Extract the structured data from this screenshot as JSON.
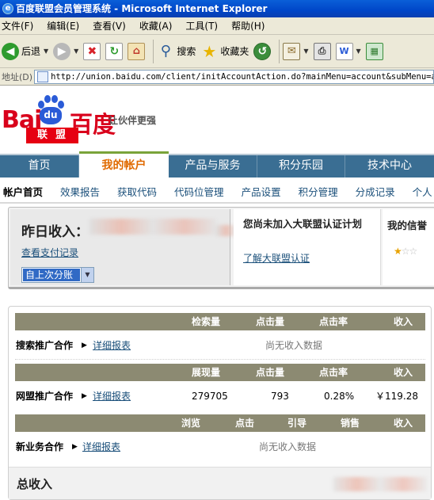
{
  "window": {
    "title": "百度联盟会员管理系统 - Microsoft Internet Explorer"
  },
  "menu": [
    "文件(F)",
    "编辑(E)",
    "查看(V)",
    "收藏(A)",
    "工具(T)",
    "帮助(H)"
  ],
  "toolbar": {
    "back": "后退",
    "search": "搜索",
    "favorites": "收藏夹"
  },
  "address": {
    "label": "地址(D)",
    "url": "http://union.baidu.com/client/initAccountAction.do?mainMenu=account&subMenu=accMa"
  },
  "logo": {
    "bai": "Bai",
    "du": "du",
    "cn": "百度",
    "union": "联盟",
    "slogan": "让伙伴更强"
  },
  "nav": {
    "items": [
      "首页",
      "我的帐户",
      "产品与服务",
      "积分乐园",
      "技术中心"
    ],
    "active": "我的帐户"
  },
  "subnav": {
    "items": [
      "帐户首页",
      "效果报告",
      "获取代码",
      "代码位管理",
      "产品设置",
      "积分管理",
      "分成记录",
      "个人"
    ],
    "current": "帐户首页"
  },
  "summary": {
    "yesterday_label": "昨日收入：",
    "pay_record_link": "查看支付记录",
    "period_select": "自上次分账",
    "cert_title": "您尚未加入大联盟认证计划",
    "cert_link": "了解大联盟认证",
    "credit_title": "我的信誉",
    "credit_stars": {
      "filled": 1,
      "total": 3
    }
  },
  "search_section": {
    "headers": [
      "检索量",
      "点击量",
      "点击率",
      "收入"
    ],
    "name": "搜索推广合作",
    "detail": "详细报表",
    "no_data": "尚无收入数据"
  },
  "union_section": {
    "headers": [
      "展现量",
      "点击量",
      "点击率",
      "收入"
    ],
    "name": "网盟推广合作",
    "detail": "详细报表",
    "values": [
      "279705",
      "793",
      "0.28%",
      "￥119.28"
    ]
  },
  "new_section": {
    "headers": [
      "浏览",
      "点击",
      "引导",
      "销售",
      "收入"
    ],
    "name": "新业务合作",
    "detail": "详细报表",
    "no_data": "尚无收入数据"
  },
  "total": {
    "label": "总收入"
  },
  "colors": {
    "nav_bg": "#3a6e93",
    "nav_active": "#e06a00",
    "header_bg": "#8c8a72",
    "link": "#1a4f7a",
    "brand_red": "#d9001b",
    "brand_blue": "#2a5bd7"
  }
}
